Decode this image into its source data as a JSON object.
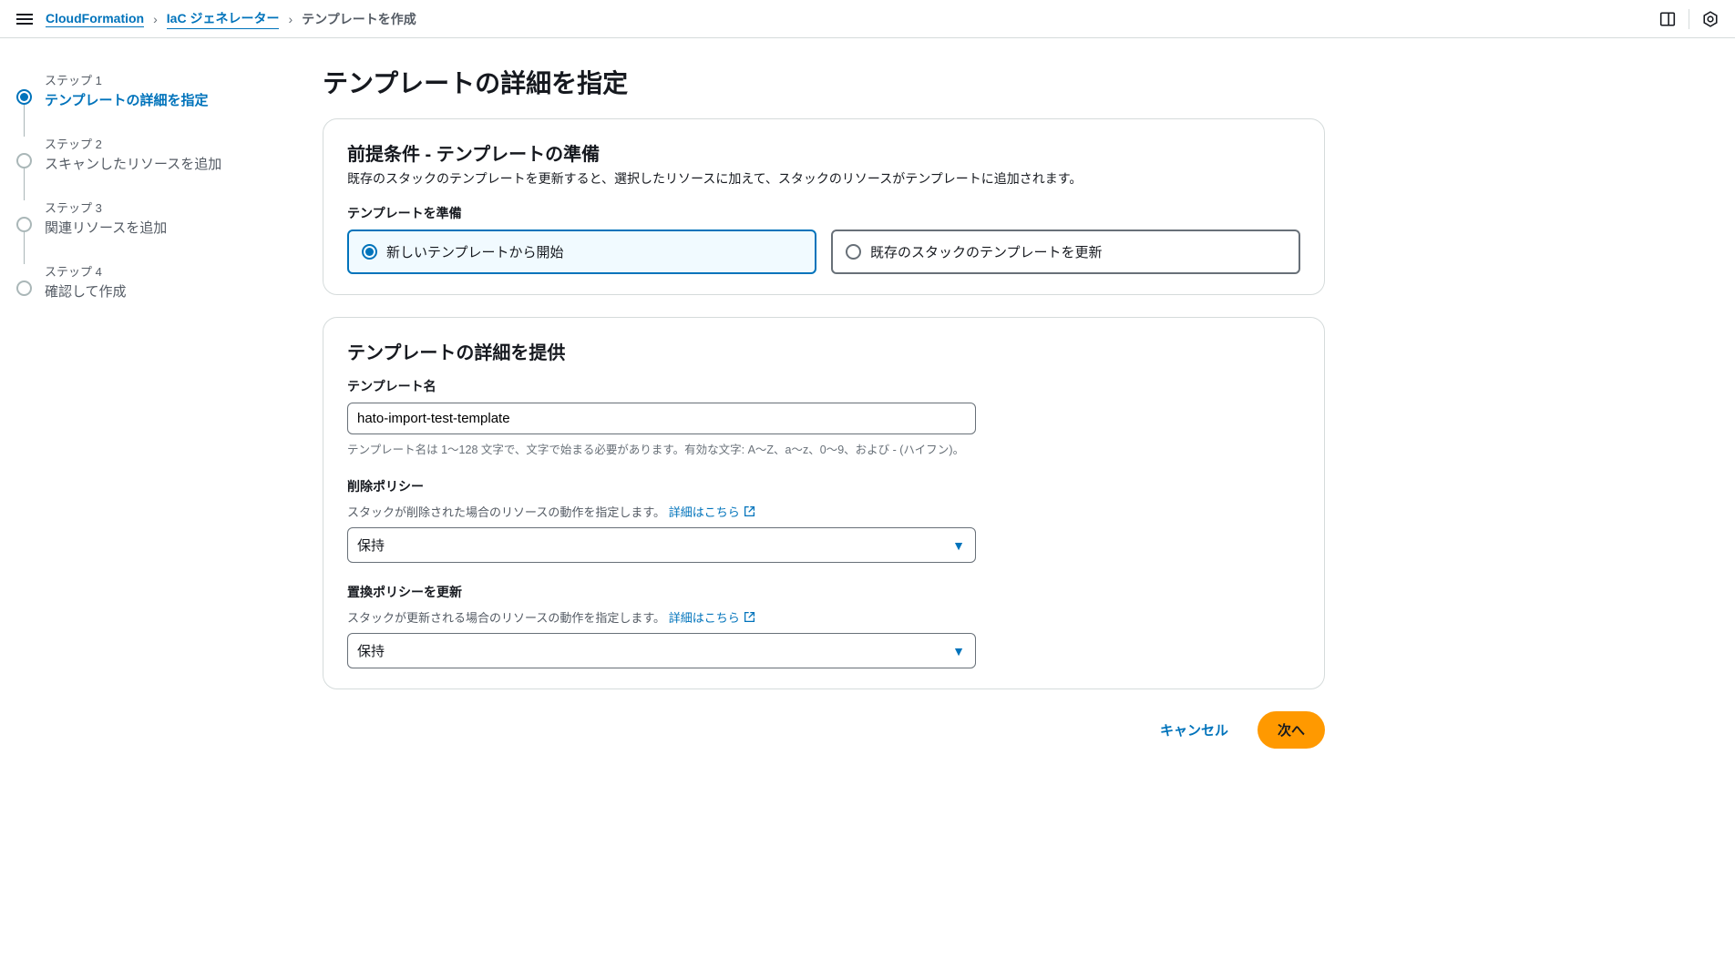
{
  "breadcrumb": {
    "items": [
      "CloudFormation",
      "IaC ジェネレーター"
    ],
    "current": "テンプレートを作成"
  },
  "wizard": {
    "steps": [
      {
        "num": "ステップ 1",
        "label": "テンプレートの詳細を指定"
      },
      {
        "num": "ステップ 2",
        "label": "スキャンしたリソースを追加"
      },
      {
        "num": "ステップ 3",
        "label": "関連リソースを追加"
      },
      {
        "num": "ステップ 4",
        "label": "確認して作成"
      }
    ]
  },
  "page": {
    "title": "テンプレートの詳細を指定"
  },
  "prereq": {
    "heading": "前提条件 - テンプレートの準備",
    "desc": "既存のスタックのテンプレートを更新すると、選択したリソースに加えて、スタックのリソースがテンプレートに追加されます。",
    "field_label": "テンプレートを準備",
    "option_new": "新しいテンプレートから開始",
    "option_existing": "既存のスタックのテンプレートを更新"
  },
  "details": {
    "heading": "テンプレートの詳細を提供",
    "name_label": "テンプレート名",
    "name_value": "hato-import-test-template",
    "name_help": "テンプレート名は 1〜128 文字で、文字で始まる必要があります。有効な文字: A〜Z、a〜z、0〜9、および - (ハイフン)。",
    "delete_label": "削除ポリシー",
    "delete_sub": "スタックが削除された場合のリソースの動作を指定します。",
    "delete_value": "保持",
    "replace_label": "置換ポリシーを更新",
    "replace_sub": "スタックが更新される場合のリソースの動作を指定します。",
    "replace_value": "保持",
    "learn_more": "詳細はこちら"
  },
  "actions": {
    "cancel": "キャンセル",
    "next": "次へ"
  }
}
